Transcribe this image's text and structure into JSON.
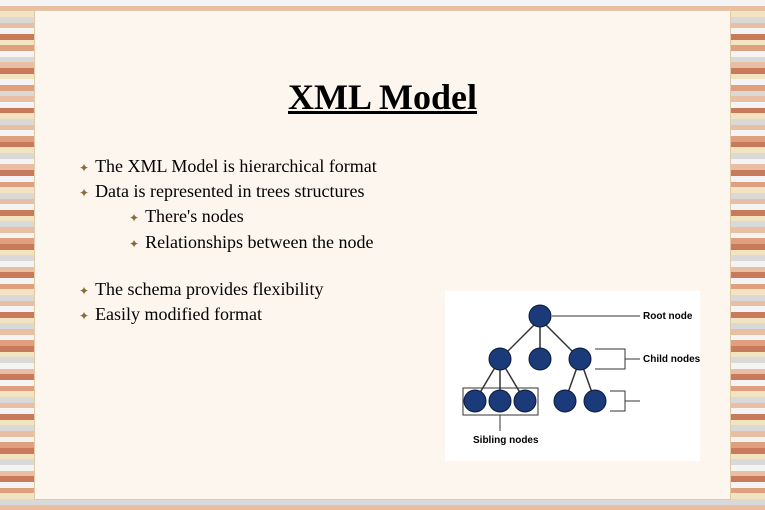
{
  "title": "XML Model",
  "bullets": {
    "b1": "The XML Model is hierarchical format",
    "b2": "Data is represented in trees structures",
    "b2a": "There's nodes",
    "b2b": "Relationships between the node",
    "b3": "The schema provides flexibility",
    "b4": "Easily modified format"
  },
  "diagram": {
    "label_root": "Root node",
    "label_child": "Child nodes",
    "label_sibling": "Sibling nodes"
  },
  "stripe_colors": [
    "#f4f4f4",
    "#e8bfa3",
    "#f2e4c0",
    "#d9d9d9",
    "#e8bfa3",
    "#f4f4f4",
    "#c97a5a",
    "#f2e4c0",
    "#e0a080",
    "#f4f4f4",
    "#d9d9d9",
    "#e8bfa3",
    "#c97a5a",
    "#f2e4c0",
    "#f4f4f4",
    "#e0a080",
    "#d9d9d9",
    "#e8bfa3",
    "#f4f4f4",
    "#c97a5a",
    "#f2e4c0",
    "#d9d9d9",
    "#e8bfa3",
    "#f4f4f4",
    "#e0a080",
    "#c97a5a",
    "#f2e4c0",
    "#d9d9d9",
    "#f4f4f4",
    "#e8bfa3",
    "#c97a5a",
    "#f4f4f4",
    "#e0a080",
    "#f2e4c0",
    "#d9d9d9",
    "#e8bfa3",
    "#f4f4f4",
    "#c97a5a",
    "#f2e4c0",
    "#d9d9d9",
    "#e8bfa3",
    "#f4f4f4",
    "#e0a080",
    "#c97a5a",
    "#f2e4c0",
    "#d9d9d9",
    "#f4f4f4",
    "#e8bfa3",
    "#c97a5a",
    "#f4f4f4",
    "#e0a080",
    "#f2e4c0",
    "#d9d9d9",
    "#e8bfa3",
    "#f4f4f4",
    "#c97a5a",
    "#f2e4c0",
    "#d9d9d9",
    "#e8bfa3",
    "#f4f4f4",
    "#e0a080",
    "#c97a5a",
    "#f2e4c0",
    "#d9d9d9",
    "#f4f4f4",
    "#e8bfa3",
    "#c97a5a",
    "#f4f4f4",
    "#e0a080",
    "#f2e4c0",
    "#d9d9d9",
    "#e8bfa3",
    "#f4f4f4",
    "#c97a5a",
    "#f2e4c0",
    "#d9d9d9",
    "#e8bfa3",
    "#f4f4f4",
    "#e0a080",
    "#c97a5a",
    "#f2e4c0",
    "#d9d9d9",
    "#f4f4f4",
    "#e8bfa3",
    "#c97a5a",
    "#f4f4f4",
    "#e0a080",
    "#f2e4c0",
    "#d9d9d9",
    "#e8bfa3"
  ]
}
